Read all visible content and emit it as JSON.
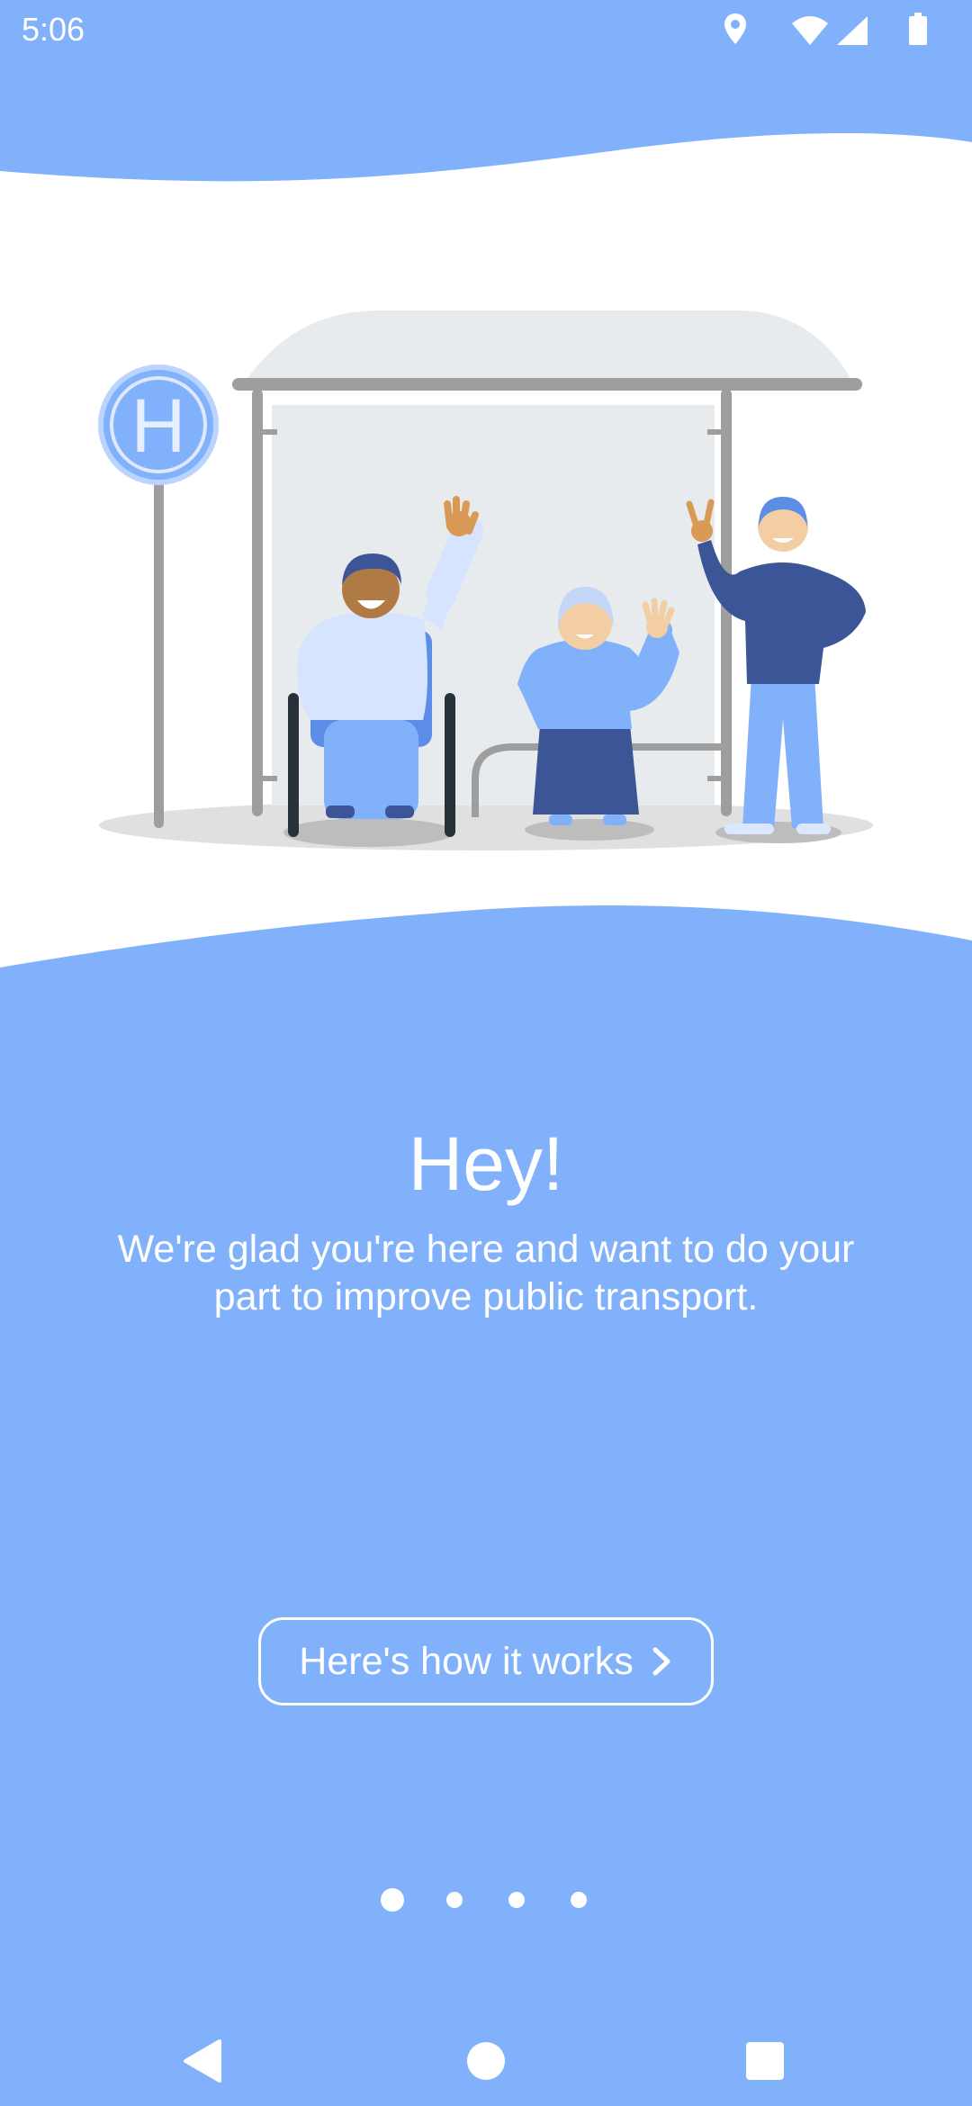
{
  "status_bar": {
    "time": "5:06",
    "icons": [
      "location-icon",
      "wifi-icon",
      "signal-icon",
      "battery-icon"
    ]
  },
  "illustration": {
    "bus_stop_sign_letter": "H"
  },
  "onboarding": {
    "title": "Hey!",
    "subtitle": "We're glad you're here and want to do your part to improve public transport.",
    "cta_label": "Here's how it works"
  },
  "pager": {
    "total_pages": 4,
    "current_page": 1
  },
  "nav_bar": {
    "icons": [
      "back-icon",
      "home-icon",
      "recents-icon"
    ]
  },
  "colors": {
    "background": "#82b1fc",
    "text": "#ffffff"
  }
}
